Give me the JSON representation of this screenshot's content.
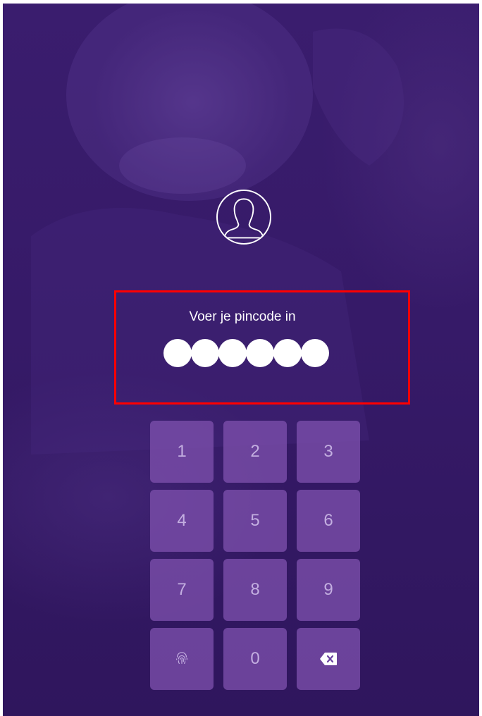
{
  "colors": {
    "background": "#361a68",
    "key_fill": "#7c50ac",
    "key_text": "#c3aee0",
    "highlight": "#ff0000",
    "pin_dot": "#ffffff"
  },
  "login": {
    "avatar_icon": "user-silhouette-icon",
    "prompt": "Voer je pincode in",
    "pin_length": 6,
    "pin_filled": 6
  },
  "keypad": {
    "keys": [
      {
        "label": "1"
      },
      {
        "label": "2"
      },
      {
        "label": "3"
      },
      {
        "label": "4"
      },
      {
        "label": "5"
      },
      {
        "label": "6"
      },
      {
        "label": "7"
      },
      {
        "label": "8"
      },
      {
        "label": "9"
      },
      {
        "icon": "fingerprint-icon"
      },
      {
        "label": "0"
      },
      {
        "icon": "backspace-icon"
      }
    ]
  }
}
